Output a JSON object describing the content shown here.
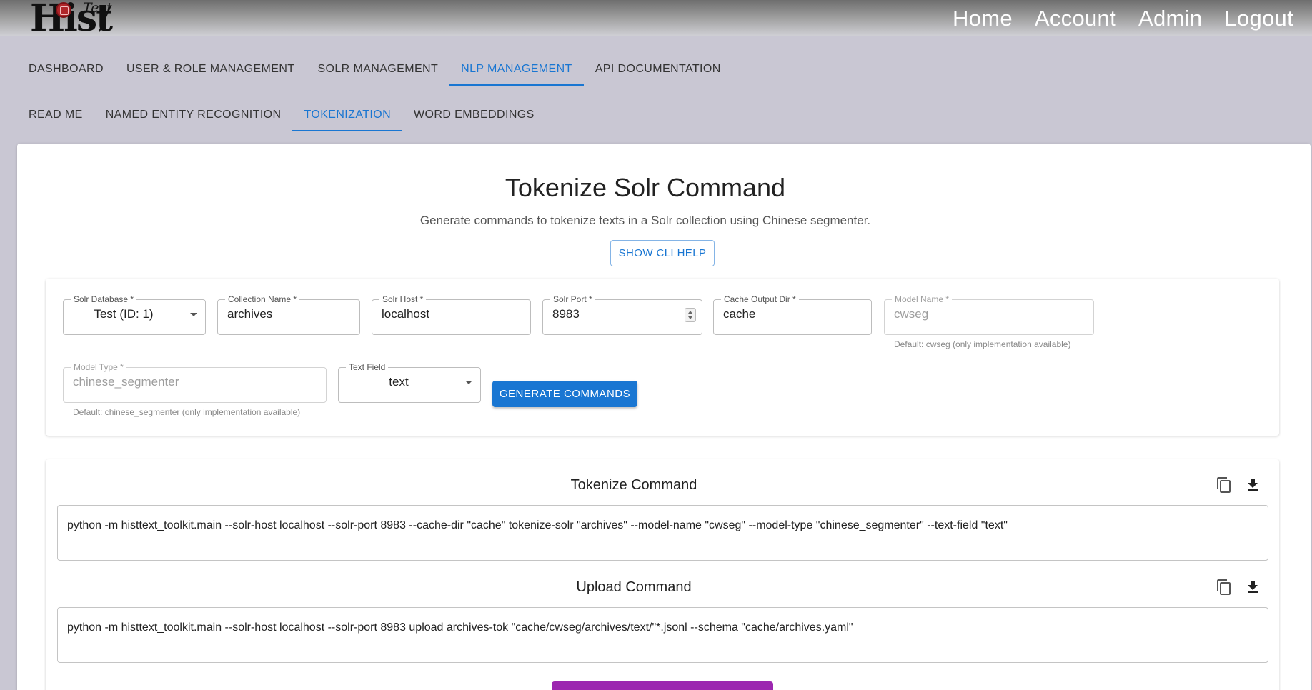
{
  "logo": {
    "main": "Hist",
    "super": "Text"
  },
  "topnav": {
    "home": "Home",
    "account": "Account",
    "admin": "Admin",
    "logout": "Logout"
  },
  "tabs": {
    "main": [
      "DASHBOARD",
      "USER & ROLE MANAGEMENT",
      "SOLR MANAGEMENT",
      "NLP MANAGEMENT",
      "API DOCUMENTATION"
    ],
    "main_active": "NLP MANAGEMENT",
    "sub": [
      "READ ME",
      "NAMED ENTITY RECOGNITION",
      "TOKENIZATION",
      "WORD EMBEDDINGS"
    ],
    "sub_active": "TOKENIZATION"
  },
  "page": {
    "title": "Tokenize Solr Command",
    "subtitle": "Generate commands to tokenize texts in a Solr collection using Chinese segmenter.",
    "cli_help": "SHOW CLI HELP"
  },
  "form": {
    "solr_database": {
      "label": "Solr Database *",
      "value": "Test (ID: 1)"
    },
    "collection_name": {
      "label": "Collection Name *",
      "value": "archives"
    },
    "solr_host": {
      "label": "Solr Host *",
      "value": "localhost"
    },
    "solr_port": {
      "label": "Solr Port *",
      "value": "8983"
    },
    "cache_output_dir": {
      "label": "Cache Output Dir *",
      "value": "cache"
    },
    "model_name": {
      "label": "Model Name *",
      "value": "cwseg",
      "helper": "Default: cwseg (only implementation available)"
    },
    "model_type": {
      "label": "Model Type *",
      "value": "chinese_segmenter",
      "helper": "Default: chinese_segmenter (only implementation available)"
    },
    "text_field": {
      "label": "Text Field",
      "value": "text"
    },
    "generate": "GENERATE COMMANDS"
  },
  "commands": {
    "tokenize": {
      "title": "Tokenize Command",
      "text": "python -m histtext_toolkit.main --solr-host localhost --solr-port 8983 --cache-dir \"cache\" tokenize-solr \"archives\" --model-name \"cwseg\" --model-type \"chinese_segmenter\" --text-field \"text\""
    },
    "upload": {
      "title": "Upload Command",
      "text": "python -m histtext_toolkit.main --solr-host localhost --solr-port 8983 upload archives-tok \"cache/cwseg/archives/text/\"*.jsonl --schema \"cache/archives.yaml\""
    }
  },
  "icons": {
    "copy": "copy-icon",
    "download": "download-icon"
  },
  "colors": {
    "accent": "#1976d2",
    "purple": "#9c27b0",
    "background": "#c9c7d3"
  }
}
